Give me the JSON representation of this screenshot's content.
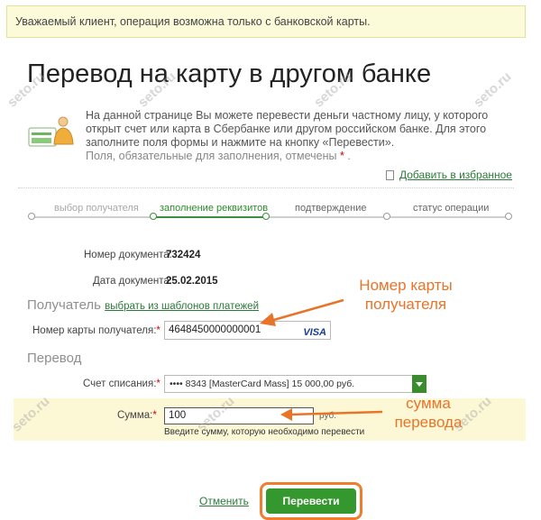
{
  "notice": "Уважаемый клиент, операция возможна только с банковской карты.",
  "title": "Перевод на карту в другом банке",
  "intro": {
    "text": "На данной странице Вы можете перевести деньги частному лицу, у которого открыт счет или карта в Сбербанке или другом российском банке. Для этого заполните поля формы и нажмите на кнопку «Перевести».",
    "required_hint": "Поля, обязательные для заполнения, отмечены",
    "star": "*",
    "dot": "."
  },
  "favorites_link": "Добавить в избранное",
  "steps": [
    "выбор получателя",
    "заполнение реквизитов",
    "подтверждение",
    "статус операции"
  ],
  "doc": {
    "number_label": "Номер документа:",
    "number_value": "732424",
    "date_label": "Дата документа:",
    "date_value": "25.02.2015"
  },
  "recipient": {
    "section_title": "Получатель",
    "templates_link": "выбрать из шаблонов платежей",
    "card_label": "Номер карты получателя:",
    "card_value": "4648450000000001",
    "card_brand": "VISA"
  },
  "transfer": {
    "section_title": "Перевод",
    "account_label": "Счет списания:",
    "account_value": "•••• 8343  [MasterCard Mass] 15 000,00  руб.",
    "amount_label": "Сумма:",
    "amount_value": "100",
    "currency": "руб.",
    "amount_hint": "Введите сумму, которую необходимо перевести"
  },
  "annotations": {
    "card": "Номер карты получателя",
    "amount": "сумма перевода"
  },
  "actions": {
    "cancel": "Отменить",
    "submit": "Перевести"
  },
  "watermark": "seto.ru",
  "colors": {
    "accent_green": "#34982f",
    "link_green": "#2c7a3a",
    "annotation_orange": "#e8742a",
    "notice_bg": "#fbfad9",
    "highlight_bg": "#fcf8d6"
  }
}
